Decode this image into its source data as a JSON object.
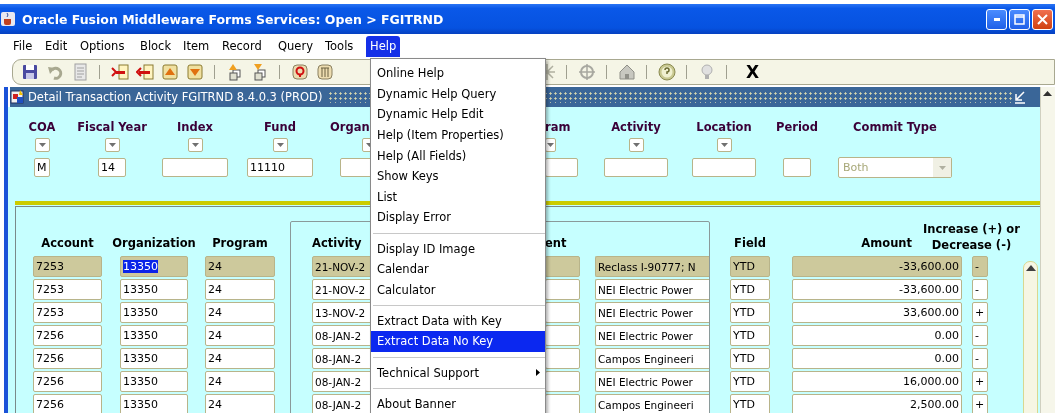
{
  "window": {
    "title": "Oracle Fusion Middleware Forms Services:  Open > FGITRND"
  },
  "menu_bar": [
    {
      "label": "File",
      "selected": false
    },
    {
      "label": "Edit",
      "selected": false
    },
    {
      "label": "Options",
      "selected": false
    },
    {
      "label": "Block",
      "selected": false
    },
    {
      "label": "Item",
      "selected": false
    },
    {
      "label": "Record",
      "selected": false
    },
    {
      "label": "Query",
      "selected": false
    },
    {
      "label": "Tools",
      "selected": false
    },
    {
      "label": "Help",
      "selected": true
    }
  ],
  "toolbar": {
    "exit_label": "X"
  },
  "form": {
    "title": "Detail Transaction Activity  FGITRND  8.4.0.3  (PROD)"
  },
  "key_block": {
    "fields": [
      {
        "label": "COA",
        "kind": "lov",
        "value": "M"
      },
      {
        "label": "Fiscal Year",
        "kind": "lov",
        "value": "14"
      },
      {
        "label": "Index",
        "kind": "lov"
      },
      {
        "label": "Fund",
        "kind": "lov",
        "value": "11110"
      },
      {
        "label": "Organ",
        "kind": "lov"
      },
      {
        "label": "ram",
        "kind": "lov"
      },
      {
        "label": "Activity",
        "kind": "lov"
      },
      {
        "label": "Location",
        "kind": "lov"
      },
      {
        "label": "Period",
        "kind": "text"
      },
      {
        "label": "Commit Type",
        "kind": "select",
        "value": "Both",
        "disabled": true
      }
    ]
  },
  "detail_block": {
    "headers": {
      "account": "Account",
      "organization": "Organization",
      "program": "Program",
      "activity_date": "Activity",
      "document": "ent",
      "field": "Field",
      "amount": "Amount",
      "sign": "Increase (+) or Decrease (-)"
    },
    "rows": [
      {
        "account": "7253",
        "organization": "13350",
        "program": "24",
        "activity_date": "21-NOV-2",
        "description": "Reclass I-90777; N",
        "field": "YTD",
        "amount": "-33,600.00",
        "sign": "-",
        "current": true
      },
      {
        "account": "7253",
        "organization": "13350",
        "program": "24",
        "activity_date": "21-NOV-2",
        "description": "NEI Electric Power",
        "field": "YTD",
        "amount": "-33,600.00",
        "sign": "-",
        "current": false
      },
      {
        "account": "7253",
        "organization": "13350",
        "program": "24",
        "activity_date": "13-NOV-2",
        "description": "NEI Electric Power",
        "field": "YTD",
        "amount": "33,600.00",
        "sign": "+",
        "current": false
      },
      {
        "account": "7256",
        "organization": "13350",
        "program": "24",
        "activity_date": "08-JAN-2",
        "description": "NEI Electric Power",
        "field": "YTD",
        "amount": "0.00",
        "sign": "-",
        "current": false
      },
      {
        "account": "7256",
        "organization": "13350",
        "program": "24",
        "activity_date": "08-JAN-2",
        "description": "Campos Engineeri",
        "field": "YTD",
        "amount": "0.00",
        "sign": "-",
        "current": false
      },
      {
        "account": "7256",
        "organization": "13350",
        "program": "24",
        "activity_date": "08-JAN-2",
        "description": "NEI Electric Power",
        "field": "YTD",
        "amount": "16,000.00",
        "sign": "+",
        "current": false
      },
      {
        "account": "7256",
        "organization": "13350",
        "program": "24",
        "activity_date": "08-JAN-2",
        "description": "Campos Engineeri",
        "field": "YTD",
        "amount": "2,500.00",
        "sign": "+",
        "current": false
      }
    ]
  },
  "help_menu": {
    "groups": [
      [
        {
          "label": "Online Help",
          "selected": false,
          "submenu": false
        },
        {
          "label": "Dynamic Help Query",
          "selected": false,
          "submenu": false
        },
        {
          "label": "Dynamic Help Edit",
          "selected": false,
          "submenu": false
        },
        {
          "label": "Help (Item Properties)",
          "selected": false,
          "submenu": false
        },
        {
          "label": "Help (All Fields)",
          "selected": false,
          "submenu": false
        },
        {
          "label": "Show Keys",
          "selected": false,
          "submenu": false
        },
        {
          "label": "List",
          "selected": false,
          "submenu": false
        },
        {
          "label": "Display Error",
          "selected": false,
          "submenu": false
        }
      ],
      [
        {
          "label": "Display ID Image",
          "selected": false,
          "submenu": false
        },
        {
          "label": "Calendar",
          "selected": false,
          "submenu": false
        },
        {
          "label": "Calculator",
          "selected": false,
          "submenu": false
        }
      ],
      [
        {
          "label": "Extract Data with Key",
          "selected": false,
          "submenu": false
        },
        {
          "label": "Extract Data No Key",
          "selected": true,
          "submenu": false
        }
      ],
      [
        {
          "label": "Technical Support",
          "selected": false,
          "submenu": true
        }
      ],
      [
        {
          "label": "About Banner",
          "selected": false,
          "submenu": false
        }
      ]
    ]
  }
}
